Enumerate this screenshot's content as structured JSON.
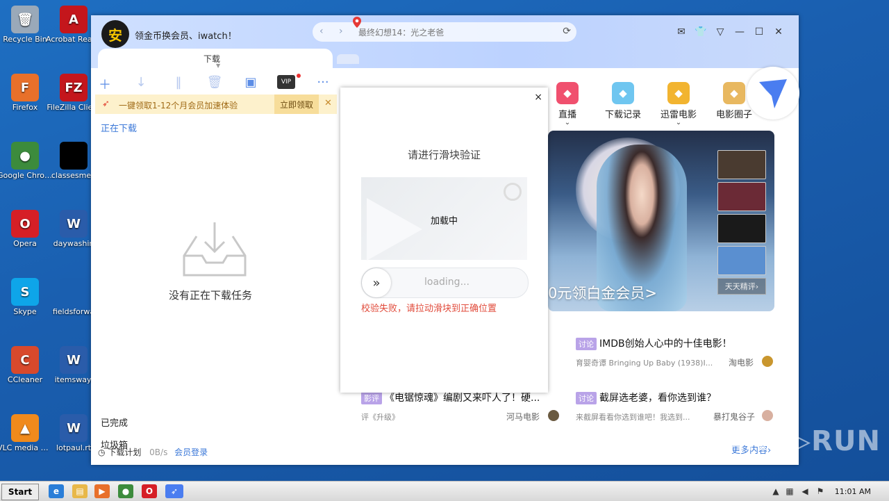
{
  "desktop": {
    "icons": [
      {
        "label": "Recycle Bin",
        "glyph": "🗑",
        "color": "#9aa9b9"
      },
      {
        "label": "Firefox",
        "glyph": "F",
        "color": "#e8702a"
      },
      {
        "label": "Google Chrome",
        "glyph": "●",
        "color": "#3c8b3c"
      },
      {
        "label": "Opera",
        "glyph": "O",
        "color": "#d61f26"
      },
      {
        "label": "Skype",
        "glyph": "S",
        "color": "#0ea5e9"
      },
      {
        "label": "CCleaner",
        "glyph": "C",
        "color": "#d8492c"
      },
      {
        "label": "VLC media player",
        "glyph": "▲",
        "color": "#f08a1c"
      }
    ],
    "icons2": [
      {
        "label": "Acrobat Reader DC",
        "glyph": "A",
        "color": "#c4161c"
      },
      {
        "label": "FileZilla Client",
        "glyph": "FZ",
        "color": "#c4161c"
      },
      {
        "label": "classesmen",
        "glyph": "",
        "color": "#000000"
      },
      {
        "label": "daywashin",
        "glyph": "W",
        "color": "#2a5caa"
      },
      {
        "label": "fieldsforwa",
        "glyph": "",
        "color": "#1a5fb0"
      },
      {
        "label": "itemsway.",
        "glyph": "W",
        "color": "#2a5caa"
      },
      {
        "label": "lotpaul.rt",
        "glyph": "W",
        "color": "#2a5caa"
      }
    ]
  },
  "app": {
    "avatar_glyph": "安",
    "promo_text": "领金币换会员、iwatch！",
    "search_query": "最终幻想14：光之老爸",
    "tab_download": "下载",
    "banner": {
      "text": "一键领取1-12个月会员加速体验",
      "button": "立即领取",
      "close": "✕"
    },
    "left_nav": {
      "downloading": "正在下载",
      "empty_text": "没有正在下载任务",
      "completed": "已完成",
      "trash": "垃圾箱",
      "plan": "下载计划",
      "speed": "0B/s",
      "login": "会员登录"
    },
    "vip_label": "VIP",
    "categories": [
      {
        "label": "直播",
        "icon": "tv-icon",
        "color": "#f0506e",
        "chevron": true
      },
      {
        "label": "下载记录",
        "icon": "cloud-icon",
        "color": "#6fc6f0",
        "chevron": false
      },
      {
        "label": "迅雷电影",
        "icon": "thunder-icon",
        "color": "#f2b430",
        "chevron": true
      },
      {
        "label": "电影圈子",
        "icon": "circle-icon",
        "color": "#e8b860",
        "chevron": false
      }
    ],
    "hero_text": "0元领白金会员>",
    "review_label": "天天精评›",
    "feed": [
      {
        "tag": "讨论",
        "title": "IMDB创始人心中的十佳电影！",
        "sub": "育婴奇谭 Bringing Up Baby (1938)I...",
        "author": "淘电影"
      },
      {
        "tag": "讨论",
        "title": "截屏选老婆，看你选到谁？",
        "sub": "来截屏看看你选到谁吧！我选到...",
        "author": "暴打鬼谷子"
      },
      {
        "tag": "影评",
        "title": "《电锯惊魂》编剧又来吓人了！硬...",
        "sub": "评《升级》",
        "author": "河马电影"
      }
    ],
    "more_link": "更多内容›",
    "colors": {
      "accent": "#3b78d8",
      "error": "#e14b3b"
    }
  },
  "captcha": {
    "title": "请进行滑块验证",
    "loading_label": "加载中",
    "slider_placeholder": "loading...",
    "error": "校验失败，请拉动滑块到正确位置",
    "close": "×"
  },
  "taskbar": {
    "start": "Start",
    "clock": "11:01 AM"
  }
}
